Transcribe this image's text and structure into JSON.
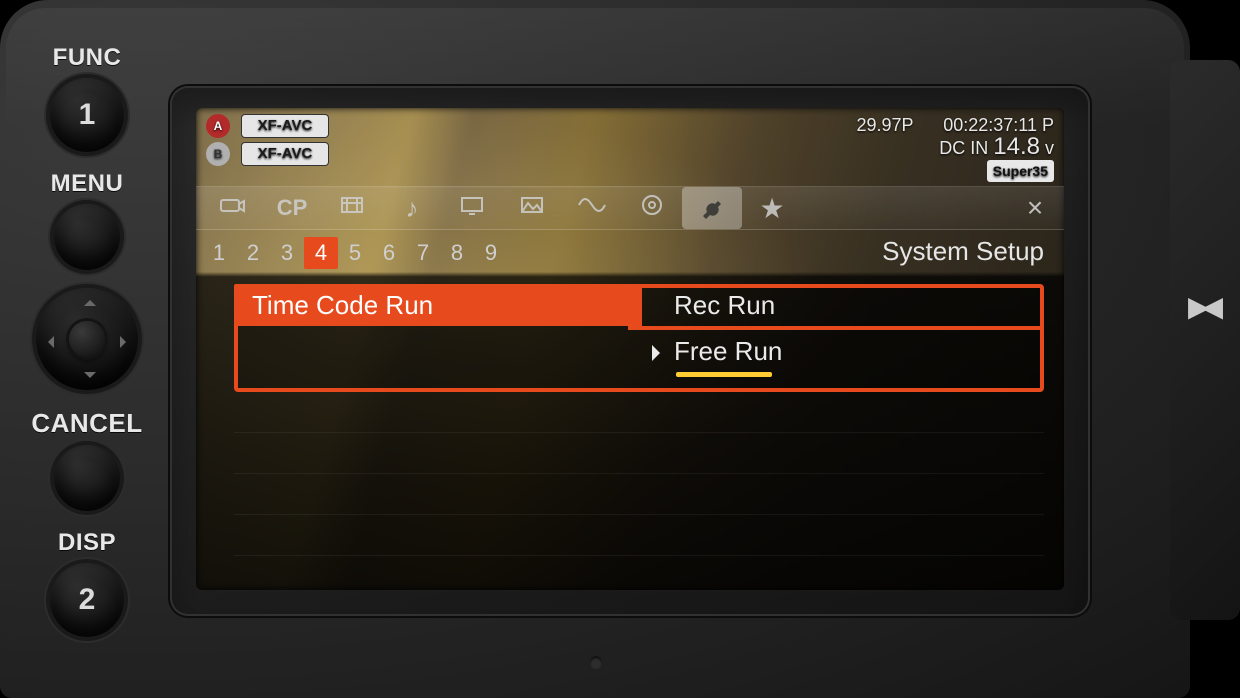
{
  "side": {
    "func": "FUNC",
    "menu": "MENU",
    "cancel": "CANCEL",
    "disp": "DISP",
    "btn1": "1",
    "btn2": "2"
  },
  "status": {
    "slotA": "A",
    "slotB": "B",
    "codecA": "XF-AVC",
    "codecB": "XF-AVC",
    "frameRate": "29.97P",
    "timecode": "00:22:37:11 P",
    "dcin_label": "DC IN ",
    "dcin_value": "14.8",
    "dcin_unit": " v",
    "sensor": "Super35"
  },
  "tabs": {
    "icons": [
      "camera",
      "CP",
      "clip",
      "audio",
      "monitor",
      "assist",
      "network",
      "media",
      "wrench",
      "star"
    ],
    "selectedIndex": 8,
    "close": "×"
  },
  "pages": {
    "list": [
      "1",
      "2",
      "3",
      "4",
      "5",
      "6",
      "7",
      "8",
      "9"
    ],
    "selected": "4"
  },
  "menu": {
    "title": "System Setup",
    "setting": "Time Code Run",
    "options": [
      "Rec Run",
      "Free Run"
    ],
    "selectedIndex": 1
  }
}
